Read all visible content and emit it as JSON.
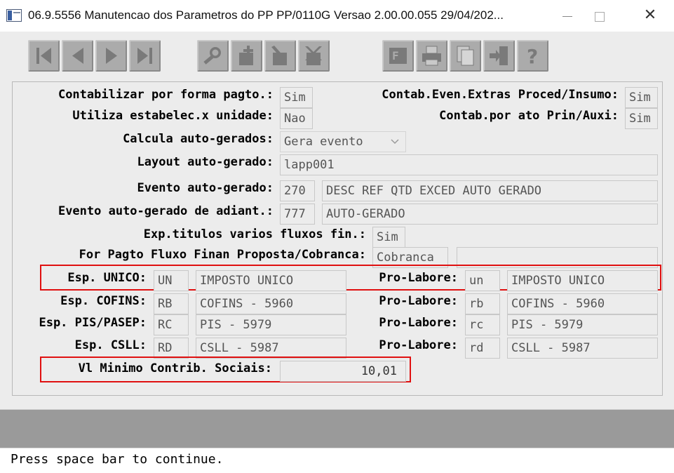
{
  "window": {
    "title": "06.9.5556 Manutencao dos  Parametros do PP PP/0110G Versao 2.00.00.055 29/04/202...",
    "close_glyph": "✕"
  },
  "toolbar": {
    "buttons": [
      {
        "icon": "first-record-icon"
      },
      {
        "icon": "previous-record-icon"
      },
      {
        "icon": "next-record-icon"
      },
      {
        "icon": "last-record-icon"
      },
      {
        "icon": "search-icon"
      },
      {
        "icon": "add-icon"
      },
      {
        "icon": "edit-icon"
      },
      {
        "icon": "delete-icon"
      },
      {
        "icon": "fields-icon"
      },
      {
        "icon": "print-icon"
      },
      {
        "icon": "copy-icon"
      },
      {
        "icon": "exit-icon"
      },
      {
        "icon": "help-icon"
      }
    ]
  },
  "form": {
    "contab_forma_pagto": {
      "label": "Contabilizar por forma pagto.:",
      "value": "Sim"
    },
    "contab_even_extras": {
      "label": "Contab.Even.Extras Proced/Insumo:",
      "value": "Sim"
    },
    "utiliza_estabelec": {
      "label": "Utiliza estabelec.x unidade:",
      "value": "Nao"
    },
    "contab_ato": {
      "label": "Contab.por ato Prin/Auxi:",
      "value": "Sim"
    },
    "calcula_auto": {
      "label": "Calcula auto-gerados:",
      "value": "Gera evento"
    },
    "layout_auto": {
      "label": "Layout auto-gerado:",
      "value": "lapp001"
    },
    "evento_auto": {
      "label": "Evento auto-gerado:",
      "code": "270",
      "desc": "DESC REF QTD EXCED AUTO GERADO"
    },
    "evento_adiant": {
      "label": "Evento auto-gerado de adiant.:",
      "code": "777",
      "desc": "AUTO-GERADO"
    },
    "exp_titulos": {
      "label": "Exp.titulos varios fluxos fin.:",
      "value": "Sim"
    },
    "for_pagto_fluxo": {
      "label": "For Pagto Fluxo Finan Proposta/Cobranca:",
      "value": "Cobranca",
      "extra": ""
    },
    "esp_unico": {
      "label": "Esp. UNICO:",
      "code": "UN",
      "desc": "IMPOSTO UNICO",
      "pl_label": "Pro-Labore:",
      "pl_code": "un",
      "pl_desc": "IMPOSTO UNICO"
    },
    "esp_cofins": {
      "label": "Esp. COFINS:",
      "code": "RB",
      "desc": "COFINS - 5960",
      "pl_label": "Pro-Labore:",
      "pl_code": "rb",
      "pl_desc": "COFINS - 5960"
    },
    "esp_pis": {
      "label": "Esp. PIS/PASEP:",
      "code": "RC",
      "desc": "PIS - 5979",
      "pl_label": "Pro-Labore:",
      "pl_code": "rc",
      "pl_desc": "PIS - 5979"
    },
    "esp_csll": {
      "label": "Esp. CSLL:",
      "code": "RD",
      "desc": "CSLL - 5987",
      "pl_label": "Pro-Labore:",
      "pl_code": "rd",
      "pl_desc": "CSLL - 5987"
    },
    "vl_minimo": {
      "label": "Vl Minimo Contrib. Sociais:",
      "value": "10,01"
    }
  },
  "status": {
    "message": "Press space bar to continue."
  },
  "colors": {
    "highlight": "#e01010",
    "toolbar_button": "#ababab",
    "status_strip": "#9a9a9a"
  }
}
